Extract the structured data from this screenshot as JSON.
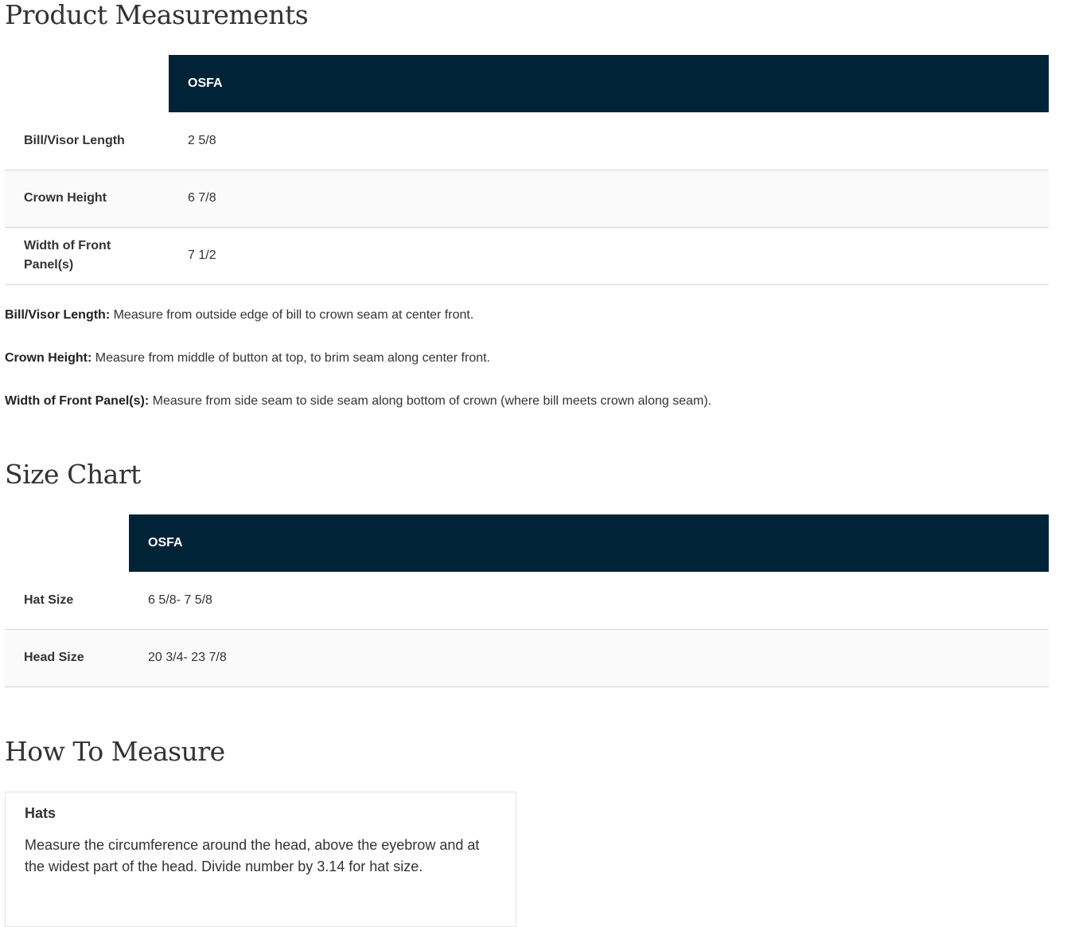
{
  "product_measurements": {
    "title": "Product Measurements",
    "header": "OSFA",
    "rows": [
      {
        "label": "Bill/Visor Length",
        "value": "2 5/8"
      },
      {
        "label": "Crown Height",
        "value": "6 7/8"
      },
      {
        "label": "Width of Front Panel(s)",
        "value": "7 1/2"
      }
    ]
  },
  "notes": [
    {
      "term": "Bill/Visor Length:",
      "text": " Measure from outside edge of bill to crown seam at center front."
    },
    {
      "term": "Crown Height:",
      "text": " Measure from middle of button at top, to brim seam along center front."
    },
    {
      "term": "Width of Front Panel(s):",
      "text": " Measure from side seam to side seam along bottom of crown (where bill meets crown along seam)."
    }
  ],
  "size_chart": {
    "title": "Size Chart",
    "header": "OSFA",
    "rows": [
      {
        "label": "Hat Size",
        "value": "6 5/8- 7 5/8"
      },
      {
        "label": "Head Size",
        "value": "20 3/4- 23 7/8"
      }
    ]
  },
  "how_to_measure": {
    "title": "How To Measure",
    "card_title": "Hats",
    "card_text": "Measure the circumference around the head, above the eyebrow and at the widest part of the head. Divide number by 3.14 for hat size."
  }
}
